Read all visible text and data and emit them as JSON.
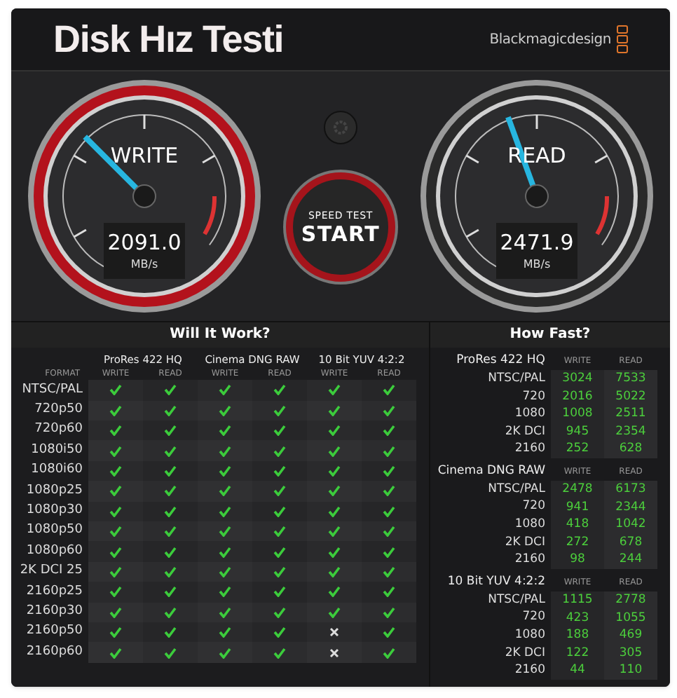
{
  "window": {
    "title": "Disk Hız Testi",
    "brand": "Blackmagicdesign"
  },
  "gauges": [
    {
      "label": "WRITE",
      "value": "2091.0",
      "unit": "MB/s",
      "kind": "write"
    },
    {
      "label": "READ",
      "value": "2471.9",
      "unit": "MB/s",
      "kind": "read"
    }
  ],
  "start_button": {
    "caption": "SPEED TEST",
    "label": "START"
  },
  "will_it_work": {
    "title": "Will It Work?",
    "format_heading": "FORMAT",
    "codecs": [
      {
        "name": "ProRes 422 HQ",
        "columns": [
          "WRITE",
          "READ"
        ]
      },
      {
        "name": "Cinema DNG RAW",
        "columns": [
          "WRITE",
          "READ"
        ]
      },
      {
        "name": "10 Bit YUV 4:2:2",
        "columns": [
          "WRITE",
          "READ"
        ]
      }
    ],
    "rows": [
      {
        "format": "NTSC/PAL",
        "results": [
          true,
          true,
          true,
          true,
          true,
          true
        ]
      },
      {
        "format": "720p50",
        "results": [
          true,
          true,
          true,
          true,
          true,
          true
        ]
      },
      {
        "format": "720p60",
        "results": [
          true,
          true,
          true,
          true,
          true,
          true
        ]
      },
      {
        "format": "1080i50",
        "results": [
          true,
          true,
          true,
          true,
          true,
          true
        ]
      },
      {
        "format": "1080i60",
        "results": [
          true,
          true,
          true,
          true,
          true,
          true
        ]
      },
      {
        "format": "1080p25",
        "results": [
          true,
          true,
          true,
          true,
          true,
          true
        ]
      },
      {
        "format": "1080p30",
        "results": [
          true,
          true,
          true,
          true,
          true,
          true
        ]
      },
      {
        "format": "1080p50",
        "results": [
          true,
          true,
          true,
          true,
          true,
          true
        ]
      },
      {
        "format": "1080p60",
        "results": [
          true,
          true,
          true,
          true,
          true,
          true
        ]
      },
      {
        "format": "2K DCI 25",
        "results": [
          true,
          true,
          true,
          true,
          true,
          true
        ]
      },
      {
        "format": "2160p25",
        "results": [
          true,
          true,
          true,
          true,
          true,
          true
        ]
      },
      {
        "format": "2160p30",
        "results": [
          true,
          true,
          true,
          true,
          true,
          true
        ]
      },
      {
        "format": "2160p50",
        "results": [
          true,
          true,
          true,
          true,
          false,
          true
        ]
      },
      {
        "format": "2160p60",
        "results": [
          true,
          true,
          true,
          true,
          false,
          true
        ]
      }
    ]
  },
  "how_fast": {
    "title": "How Fast?",
    "groups": [
      {
        "codec": "ProRes 422 HQ",
        "columns": [
          "WRITE",
          "READ"
        ],
        "rows": [
          {
            "format": "NTSC/PAL",
            "write": "3024",
            "read": "7533"
          },
          {
            "format": "720",
            "write": "2016",
            "read": "5022"
          },
          {
            "format": "1080",
            "write": "1008",
            "read": "2511"
          },
          {
            "format": "2K DCI",
            "write": "945",
            "read": "2354"
          },
          {
            "format": "2160",
            "write": "252",
            "read": "628"
          }
        ]
      },
      {
        "codec": "Cinema DNG RAW",
        "columns": [
          "WRITE",
          "READ"
        ],
        "rows": [
          {
            "format": "NTSC/PAL",
            "write": "2478",
            "read": "6173"
          },
          {
            "format": "720",
            "write": "941",
            "read": "2344"
          },
          {
            "format": "1080",
            "write": "418",
            "read": "1042"
          },
          {
            "format": "2K DCI",
            "write": "272",
            "read": "678"
          },
          {
            "format": "2160",
            "write": "98",
            "read": "244"
          }
        ]
      },
      {
        "codec": "10 Bit YUV 4:2:2",
        "columns": [
          "WRITE",
          "READ"
        ],
        "rows": [
          {
            "format": "NTSC/PAL",
            "write": "1115",
            "read": "2778"
          },
          {
            "format": "720",
            "write": "423",
            "read": "1055"
          },
          {
            "format": "1080",
            "write": "188",
            "read": "469"
          },
          {
            "format": "2K DCI",
            "write": "122",
            "read": "305"
          },
          {
            "format": "2160",
            "write": "44",
            "read": "110"
          }
        ]
      }
    ]
  }
}
